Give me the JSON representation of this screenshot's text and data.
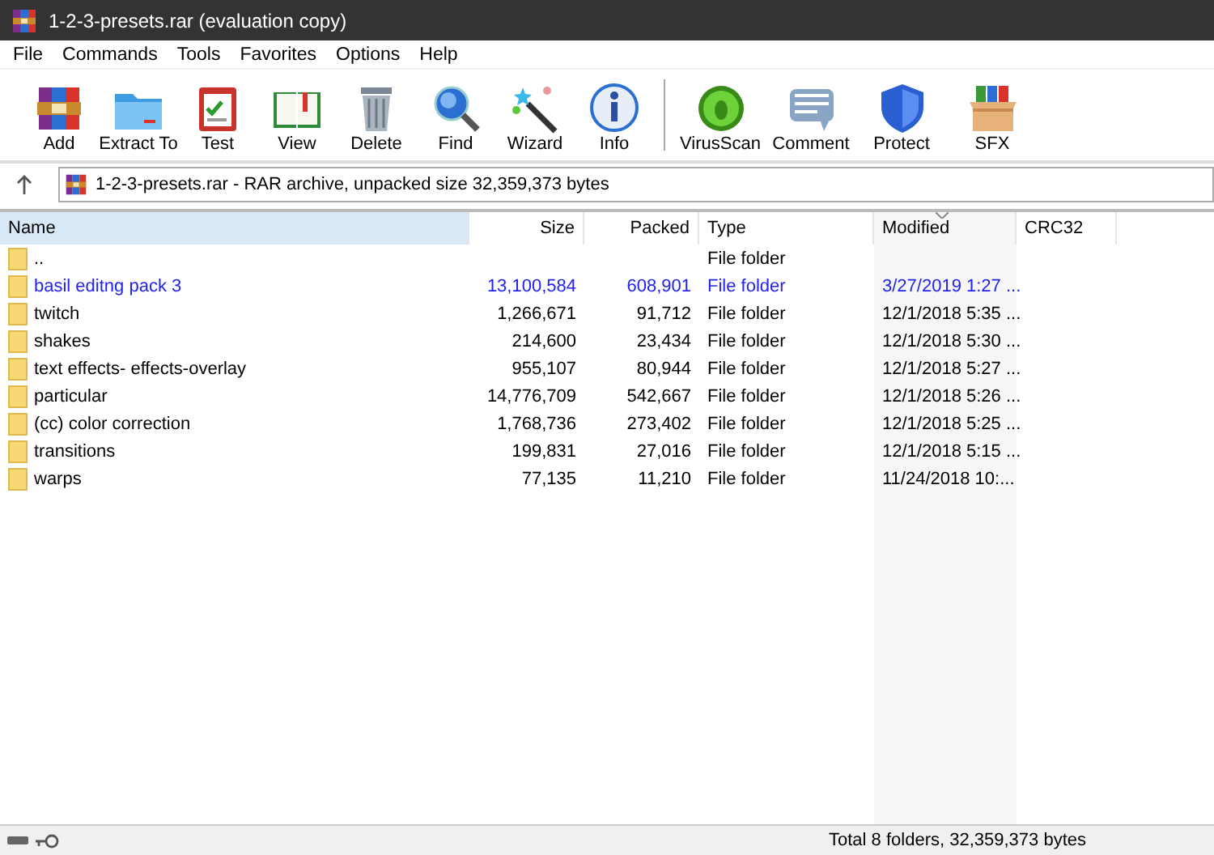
{
  "window": {
    "title": "1-2-3-presets.rar (evaluation copy)"
  },
  "menu": [
    "File",
    "Commands",
    "Tools",
    "Favorites",
    "Options",
    "Help"
  ],
  "toolbar": {
    "groups": [
      [
        "Add",
        "Extract To",
        "Test",
        "View",
        "Delete",
        "Find",
        "Wizard",
        "Info"
      ],
      [
        "VirusScan",
        "Comment",
        "Protect",
        "SFX"
      ]
    ]
  },
  "address": {
    "text": "1-2-3-presets.rar - RAR archive, unpacked size 32,359,373 bytes"
  },
  "table": {
    "columns": [
      {
        "label": "Name",
        "hovered": true,
        "sorted": false
      },
      {
        "label": "Size",
        "hovered": false,
        "sorted": false
      },
      {
        "label": "Packed",
        "hovered": false,
        "sorted": false
      },
      {
        "label": "Type",
        "hovered": false,
        "sorted": false
      },
      {
        "label": "Modified",
        "hovered": false,
        "sorted": true
      },
      {
        "label": "CRC32",
        "hovered": false,
        "sorted": false
      }
    ],
    "rows": [
      {
        "name": "..",
        "type": "File folder",
        "highlighted": false
      },
      {
        "name": "basil editng pack 3",
        "size": "13,100,584",
        "packed": "608,901",
        "type": "File folder",
        "modified": "3/27/2019 1:27 ...",
        "highlighted": true
      },
      {
        "name": "twitch",
        "size": "1,266,671",
        "packed": "91,712",
        "type": "File folder",
        "modified": "12/1/2018 5:35 ...",
        "highlighted": false
      },
      {
        "name": "shakes",
        "size": "214,600",
        "packed": "23,434",
        "type": "File folder",
        "modified": "12/1/2018 5:30 ...",
        "highlighted": false
      },
      {
        "name": "text effects- effects-overlay",
        "size": "955,107",
        "packed": "80,944",
        "type": "File folder",
        "modified": "12/1/2018 5:27 ...",
        "highlighted": false
      },
      {
        "name": "particular",
        "size": "14,776,709",
        "packed": "542,667",
        "type": "File folder",
        "modified": "12/1/2018 5:26 ...",
        "highlighted": false
      },
      {
        "name": "(cc) color correction",
        "size": "1,768,736",
        "packed": "273,402",
        "type": "File folder",
        "modified": "12/1/2018 5:25 ...",
        "highlighted": false
      },
      {
        "name": "transitions",
        "size": "199,831",
        "packed": "27,016",
        "type": "File folder",
        "modified": "12/1/2018 5:15 ...",
        "highlighted": false
      },
      {
        "name": "warps",
        "size": "77,135",
        "packed": "11,210",
        "type": "File folder",
        "modified": "11/24/2018 10:...",
        "highlighted": false
      }
    ]
  },
  "status_bar": {
    "text": "Total 8 folders, 32,359,373 bytes"
  }
}
